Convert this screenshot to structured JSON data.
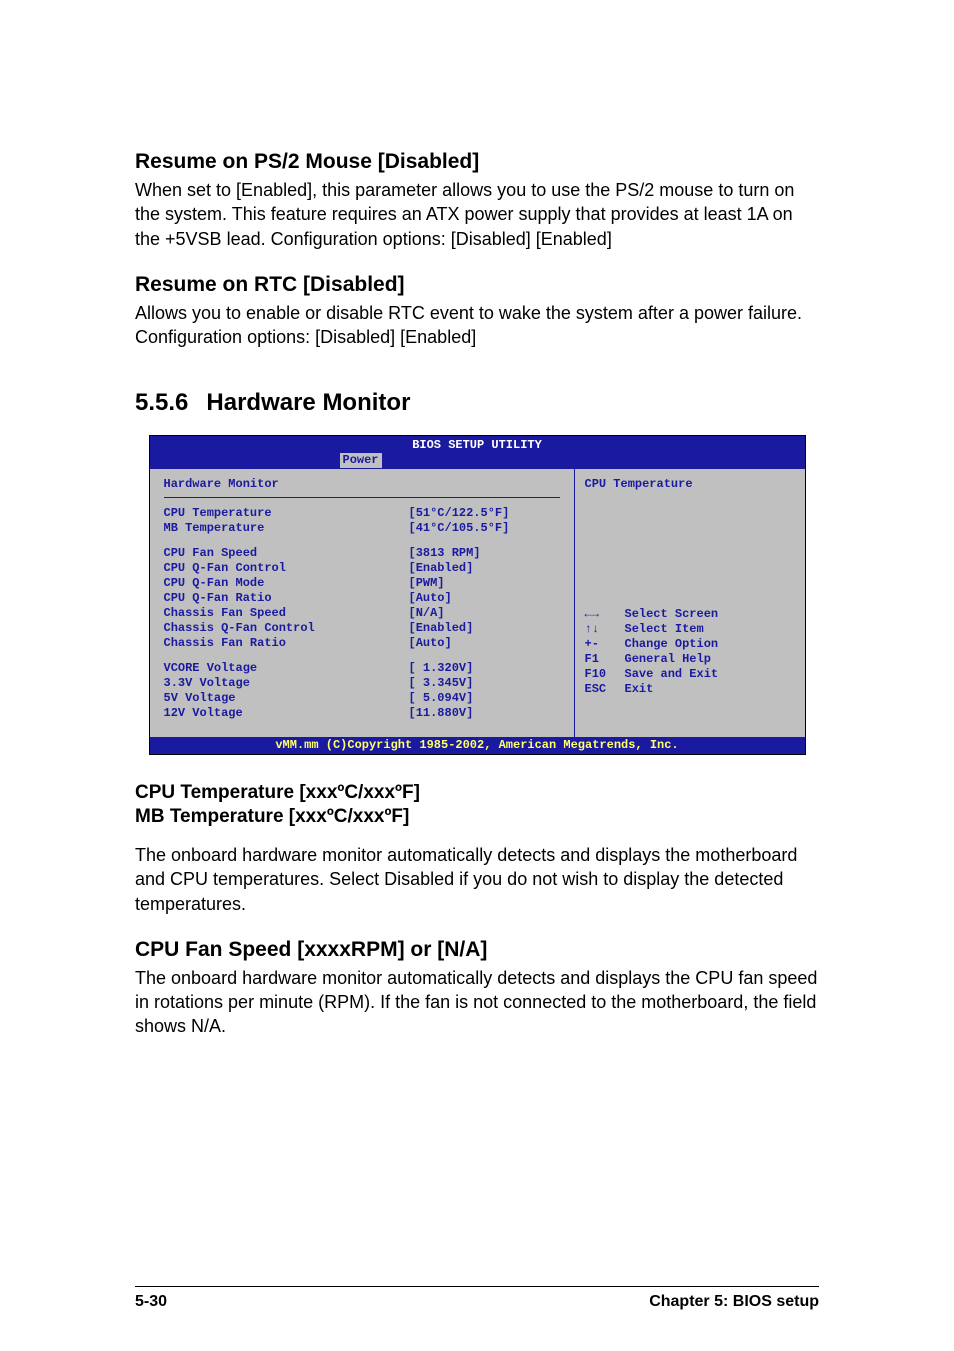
{
  "sec_ps2": {
    "title": "Resume on PS/2 Mouse [Disabled]",
    "body": "When set to [Enabled], this parameter allows you to use the PS/2 mouse to turn on the system. This feature requires an ATX power supply that provides at least 1A on the +5VSB lead. Configuration options: [Disabled] [Enabled]"
  },
  "sec_rtc": {
    "title": "Resume on RTC [Disabled]",
    "body": "Allows you to enable or disable RTC event to wake the system after a power failure. Configuration options: [Disabled] [Enabled]"
  },
  "section": {
    "num": "5.5.6",
    "title": "Hardware Monitor"
  },
  "bios": {
    "title": "BIOS SETUP UTILITY",
    "tab": "Power",
    "left_title": "Hardware Monitor",
    "group1": [
      {
        "label": "CPU Temperature",
        "val": "[51°C/122.5°F]"
      },
      {
        "label": "MB Temperature",
        "val": "[41°C/105.5°F]"
      }
    ],
    "group2": [
      {
        "label": "CPU Fan Speed",
        "val": "[3813 RPM]"
      },
      {
        "label": "CPU Q-Fan Control",
        "val": "[Enabled]"
      },
      {
        "label": "CPU Q-Fan Mode",
        "val": "[PWM]"
      },
      {
        "label": "CPU Q-Fan Ratio",
        "val": "[Auto]"
      },
      {
        "label": "Chassis Fan Speed",
        "val": "[N/A]"
      },
      {
        "label": "Chassis Q-Fan Control",
        "val": "[Enabled]"
      },
      {
        "label": "Chassis Fan Ratio",
        "val": "[Auto]"
      }
    ],
    "group3": [
      {
        "label": "VCORE Voltage",
        "val": "[ 1.320V]"
      },
      {
        "label": "3.3V Voltage",
        "val": "[ 3.345V]"
      },
      {
        "label": "5V Voltage",
        "val": "[ 5.094V]"
      },
      {
        "label": "12V Voltage",
        "val": "[11.880V]"
      }
    ],
    "right_help": "CPU Temperature",
    "nav": [
      {
        "key": "←→",
        "label": "Select Screen"
      },
      {
        "key": "↑↓",
        "label": "Select Item"
      },
      {
        "key": "+-",
        "label": "Change Option"
      },
      {
        "key": "F1",
        "label": "General Help"
      },
      {
        "key": "F10",
        "label": "Save and Exit"
      },
      {
        "key": "ESC",
        "label": "Exit"
      }
    ],
    "footer": "vMM.mm (C)Copyright 1985-2002, American Megatrends, Inc."
  },
  "sec_temp": {
    "title1": "CPU Temperature [xxxºC/xxxºF]",
    "title2": "MB Temperature [xxxºC/xxxºF]",
    "body": "The onboard hardware monitor automatically detects and displays the motherboard and CPU temperatures. Select Disabled if you do not wish to display the detected temperatures."
  },
  "sec_fan": {
    "title": "CPU Fan Speed [xxxxRPM] or [N/A]",
    "body": "The onboard hardware monitor automatically detects and displays the CPU fan speed in rotations per minute (RPM). If the fan is not connected to the motherboard, the field shows N/A."
  },
  "footer": {
    "left": "5-30",
    "right": "Chapter 5: BIOS setup"
  }
}
